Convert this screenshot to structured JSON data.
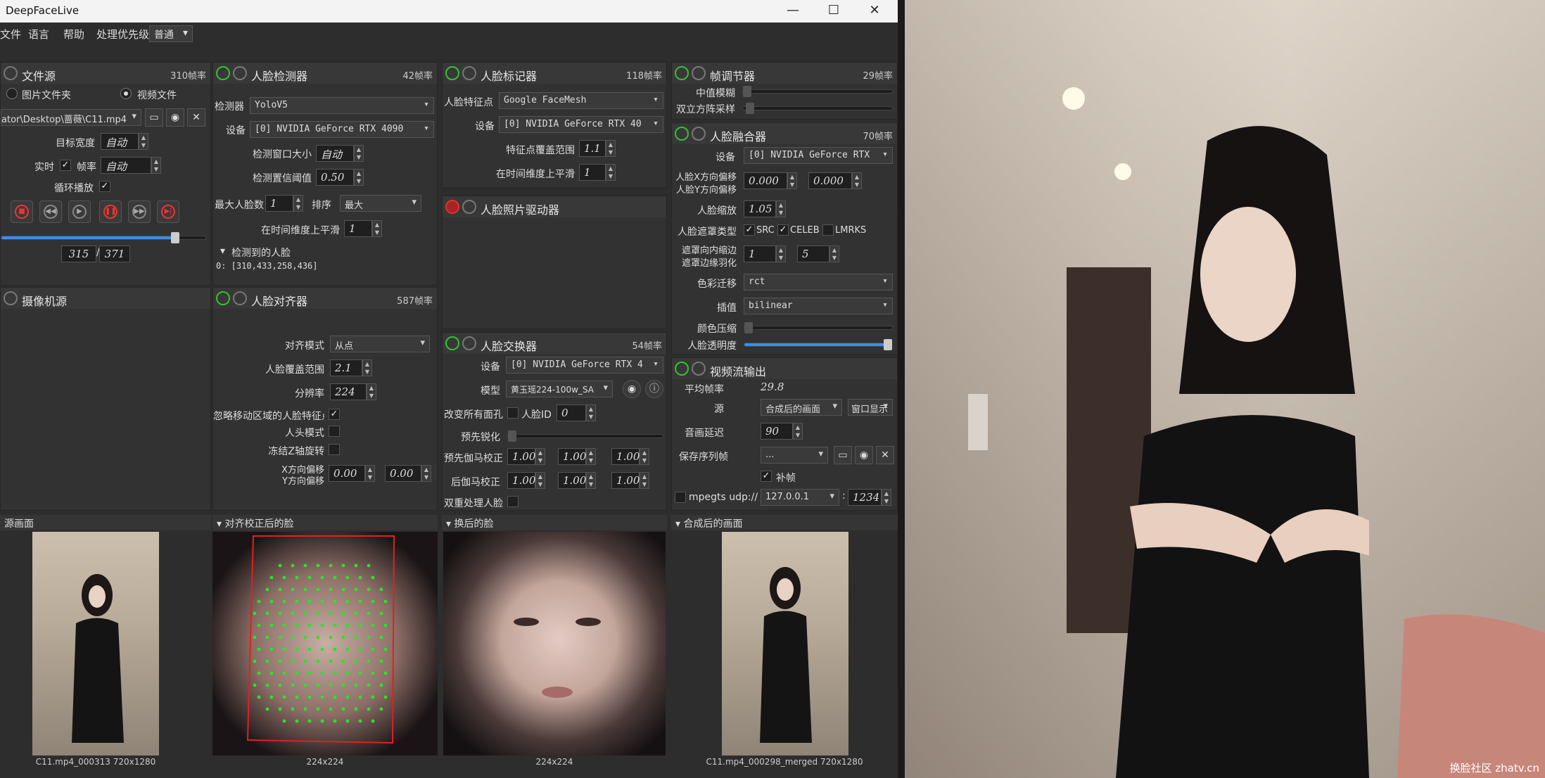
{
  "window": {
    "title": "DeepFaceLive",
    "min_icon": "minimize-icon",
    "max_icon": "maximize-icon",
    "close_icon": "close-icon"
  },
  "menu": {
    "file": "文件",
    "language": "语言",
    "help": "帮助",
    "priority_label": "处理优先级",
    "priority_value": "普通"
  },
  "file_source": {
    "title": "文件源",
    "fps": "310帧率",
    "image_folder": "图片文件夹",
    "video_file": "视频文件",
    "path": "ator\\Desktop\\蔷薇\\C11.mp4",
    "target_width_label": "目标宽度",
    "target_width_value": "自动",
    "realtime_label": "实时",
    "fps_label": "帧率",
    "fps_value": "自动",
    "loop_label": "循环播放",
    "frame_current": "315",
    "frame_total": "371",
    "progress": 0.85
  },
  "camera_source": {
    "title": "摄像机源"
  },
  "face_detector": {
    "title": "人脸检测器",
    "fps": "42帧率",
    "detector_label": "检测器",
    "detector_value": "YoloV5",
    "device_label": "设备",
    "device_value": "[0] NVIDIA GeForce RTX 4090",
    "window_size_label": "检测窗口大小",
    "window_size_value": "自动",
    "threshold_label": "检测置信阈值",
    "threshold_value": "0.50",
    "max_faces_label": "最大人脸数",
    "max_faces_value": "1",
    "sort_label": "排序",
    "sort_value": "最大",
    "temporal_label": "在时间维度上平滑",
    "temporal_value": "1",
    "detected_label": "检测到的人脸",
    "detected_value": "0: [310,433,258,436]"
  },
  "face_aligner": {
    "title": "人脸对齐器",
    "fps": "587帧率",
    "align_mode_label": "对齐模式",
    "align_mode_value": "从点",
    "coverage_label": "人脸覆盖范围",
    "coverage_value": "2.1",
    "resolution_label": "分辨率",
    "resolution_value": "224",
    "exclude_moving_label": "忽略移动区域的人脸特征点",
    "head_mode_label": "人头模式",
    "freeze_z_label": "冻结Z轴旋转",
    "x_offset_label": "X方向偏移",
    "y_offset_label": "Y方向偏移",
    "x_offset_value": "0.00",
    "y_offset_value": "0.00"
  },
  "face_marker": {
    "title": "人脸标记器",
    "fps": "118帧率",
    "marker_label": "人脸特征点",
    "marker_value": "Google FaceMesh",
    "device_label": "设备",
    "device_value": "[0] NVIDIA GeForce RTX 40",
    "range_label": "特征点覆盖范围",
    "range_value": "1.1",
    "temporal_label": "在时间维度上平滑",
    "temporal_value": "1"
  },
  "face_animator": {
    "title": "人脸照片驱动器"
  },
  "face_swapper": {
    "title": "人脸交换器",
    "fps": "54帧率",
    "device_label": "设备",
    "device_value": "[0] NVIDIA GeForce RTX 4",
    "model_label": "模型",
    "model_value": "黄玉瑶224-100w_SA",
    "swap_all_label": "改变所有面孔",
    "face_id_label": "人脸ID",
    "face_id_value": "0",
    "presharpen_label": "预先锐化",
    "pre_gamma_label": "预先伽马校正",
    "post_gamma_label": "后伽马校正",
    "gamma_values": [
      "1.00",
      "1.00",
      "1.00"
    ],
    "two_pass_label": "双重处理人脸"
  },
  "frame_adjuster": {
    "title": "帧调节器",
    "fps": "29帧率",
    "median_blur_label": "中值模糊",
    "bilateral_label": "双立方阵采样"
  },
  "face_merger": {
    "title": "人脸融合器",
    "fps": "70帧率",
    "device_label": "设备",
    "device_value": "[0] NVIDIA GeForce RTX",
    "x_offset_label": "人脸X方向偏移",
    "y_offset_label": "人脸Y方向偏移",
    "x_offset_value": "0.000",
    "y_offset_value": "0.000",
    "scale_label": "人脸缩放",
    "scale_value": "1.05",
    "mask_type_label": "人脸遮罩类型",
    "mask_src": "SRC",
    "mask_celeb": "CELEB",
    "mask_lmrks": "LMRKS",
    "erode_label": "遮罩向内缩边",
    "blur_label": "遮罩边缘羽化",
    "erode_value": "1",
    "blur_value": "5",
    "color_transfer_label": "色彩迁移",
    "color_transfer_value": "rct",
    "interp_label": "插值",
    "interp_value": "bilinear",
    "color_compress_label": "颜色压缩",
    "opacity_label": "人脸透明度",
    "opacity": 1.0
  },
  "stream_output": {
    "title": "视频流输出",
    "avg_fps_label": "平均帧率",
    "avg_fps_value": "29.8",
    "source_label": "源",
    "source_value": "合成后的画面",
    "window_btn": "窗口显示",
    "audio_delay_label": "音画延迟",
    "audio_delay_value": "90",
    "save_seq_label": "保存序列帧",
    "save_seq_value": "...",
    "fill_frames_label": "补帧",
    "mpegts_label": "mpegts udp://",
    "mpegts_host": "127.0.0.1",
    "mpegts_port": "1234"
  },
  "previews": {
    "source_title": "源画面",
    "source_caption": "C11.mp4_000313 720x1280",
    "aligned_title": "对齐校正后的脸",
    "aligned_caption": "224x224",
    "swapped_title": "换后的脸",
    "swapped_caption": "224x224",
    "merged_title": "合成后的画面",
    "merged_caption": "C11.mp4_000298_merged 720x1280"
  },
  "output_window": {
    "watermark": "换脸社区 zhatv.cn"
  }
}
